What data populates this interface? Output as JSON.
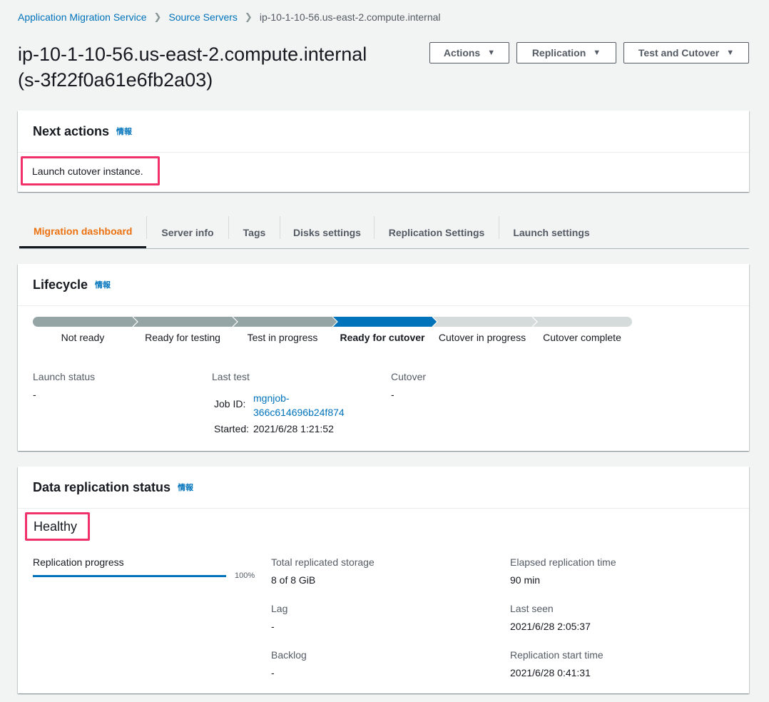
{
  "breadcrumb": {
    "items": [
      "Application Migration Service",
      "Source Servers"
    ],
    "current": "ip-10-1-10-56.us-east-2.compute.internal"
  },
  "page": {
    "title_line1": "ip-10-1-10-56.us-east-2.compute.internal",
    "title_line2": "(s-3f22f0a61e6fb2a03)"
  },
  "header_buttons": {
    "actions": "Actions",
    "replication": "Replication",
    "test_cutover": "Test and Cutover"
  },
  "next_actions": {
    "title": "Next actions",
    "info": "情報",
    "message": "Launch cutover instance."
  },
  "tabs": [
    "Migration dashboard",
    "Server info",
    "Tags",
    "Disks settings",
    "Replication Settings",
    "Launch settings"
  ],
  "lifecycle": {
    "title": "Lifecycle",
    "info": "情報",
    "steps": [
      "Not ready",
      "Ready for testing",
      "Test in progress",
      "Ready for cutover",
      "Cutover in progress",
      "Cutover complete"
    ],
    "current_step": "Ready for cutover",
    "launch_status_label": "Launch status",
    "launch_status_value": "-",
    "last_test_label": "Last test",
    "job_id_label": "Job ID:",
    "job_id_line1": "mgnjob-",
    "job_id_line2": "366c614696b24f874",
    "started_label": "Started:",
    "started_value": "2021/6/28 1:21:52",
    "cutover_label": "Cutover",
    "cutover_value": "-"
  },
  "replication": {
    "title": "Data replication status",
    "info": "情報",
    "status": "Healthy",
    "progress_label": "Replication progress",
    "progress_percent_text": "100%",
    "progress_value": 100,
    "total_storage_label": "Total replicated storage",
    "total_storage_value": "8 of 8 GiB",
    "lag_label": "Lag",
    "lag_value": "-",
    "backlog_label": "Backlog",
    "backlog_value": "-",
    "elapsed_label": "Elapsed replication time",
    "elapsed_value": "90 min",
    "last_seen_label": "Last seen",
    "last_seen_value": "2021/6/28 2:05:37",
    "start_time_label": "Replication start time",
    "start_time_value": "2021/6/28 0:41:31"
  },
  "colors": {
    "link": "#0073bb",
    "active_tab": "#ec7211",
    "highlight": "#f0316a",
    "step_done": "#95a5a6",
    "step_current": "#0073bb",
    "step_pending": "#d5dbdb"
  }
}
